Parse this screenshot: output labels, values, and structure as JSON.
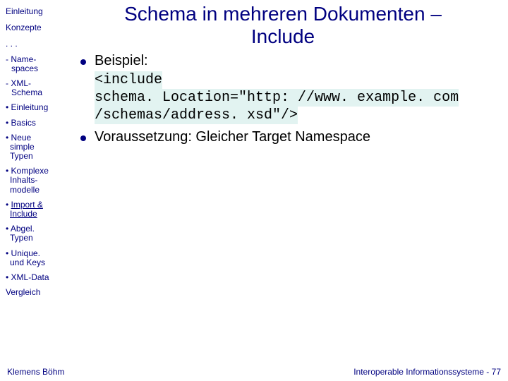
{
  "sidebar": {
    "top": [
      "Einleitung",
      "Konzepte"
    ],
    "ellipsis": ". . .",
    "dash": [
      {
        "l1": "- Name-",
        "l2": "spaces"
      },
      {
        "l1": "- XML-",
        "l2": "Schema"
      }
    ],
    "dot": [
      {
        "l1": "• Einleitung",
        "l2": ""
      },
      {
        "l1": "• Basics",
        "l2": ""
      },
      {
        "l1": "• Neue",
        "l2": "simple",
        "l3": "Typen"
      },
      {
        "l1": "• Komplexe",
        "l2": "Inhalts-",
        "l3": "modelle"
      },
      {
        "l1a": "• ",
        "l1b": "Import &",
        "l2b": "Include",
        "underline": true
      },
      {
        "l1": "• Abgel.",
        "l2": "Typen"
      },
      {
        "l1": "• Unique.",
        "l2": "und Keys"
      },
      {
        "l1": "• XML-Data",
        "l2": ""
      }
    ],
    "bottom": [
      "Vergleich"
    ]
  },
  "title": {
    "line1": "Schema in mehreren Dokumenten –",
    "line2": "Include"
  },
  "bullets": {
    "b1": "Beispiel:",
    "code": {
      "l1": "<include",
      "l2": "schema. Location=\"http: //www. example. com",
      "l3": "/schemas/address. xsd\"/>"
    },
    "b2": "Voraussetzung: Gleicher Target Namespace"
  },
  "footer": {
    "left": "Klemens Böhm",
    "right": "Interoperable Informationssysteme - 77"
  }
}
